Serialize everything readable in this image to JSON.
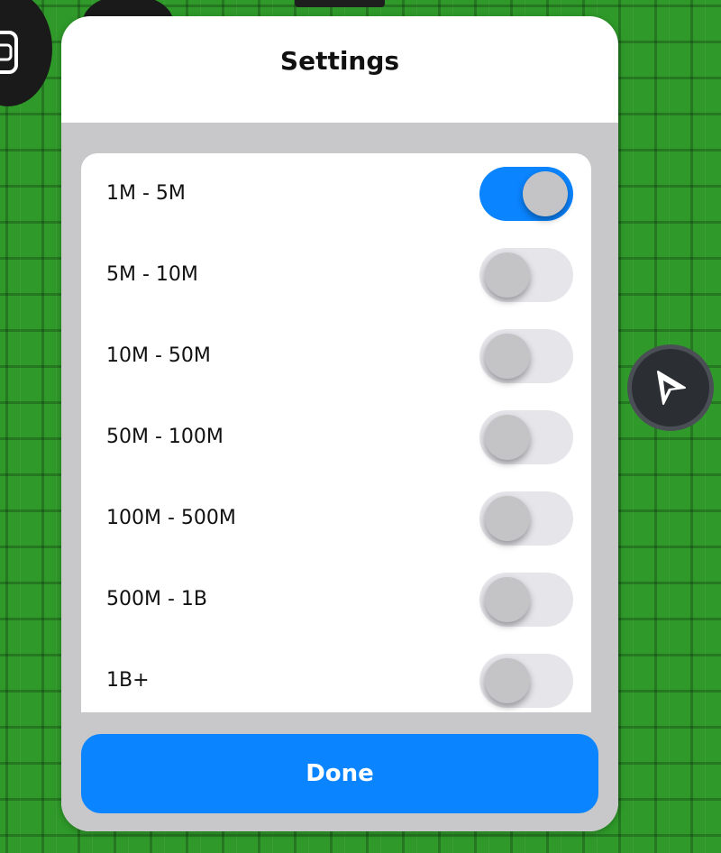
{
  "modal": {
    "title": "Settings",
    "done_label": "Done"
  },
  "ranges": [
    {
      "label": "1M - 5M",
      "enabled": true
    },
    {
      "label": "5M - 10M",
      "enabled": false
    },
    {
      "label": "10M - 50M",
      "enabled": false
    },
    {
      "label": "50M - 100M",
      "enabled": false
    },
    {
      "label": "100M - 500M",
      "enabled": false
    },
    {
      "label": "500M - 1B",
      "enabled": false
    },
    {
      "label": "1B+",
      "enabled": false
    }
  ],
  "icons": {
    "left_top": "backpack-icon",
    "right_side": "play-cursor-icon"
  },
  "colors": {
    "accent": "#0a84ff",
    "toggle_off": "#e5e5ea",
    "background": "#2f9a2a"
  }
}
